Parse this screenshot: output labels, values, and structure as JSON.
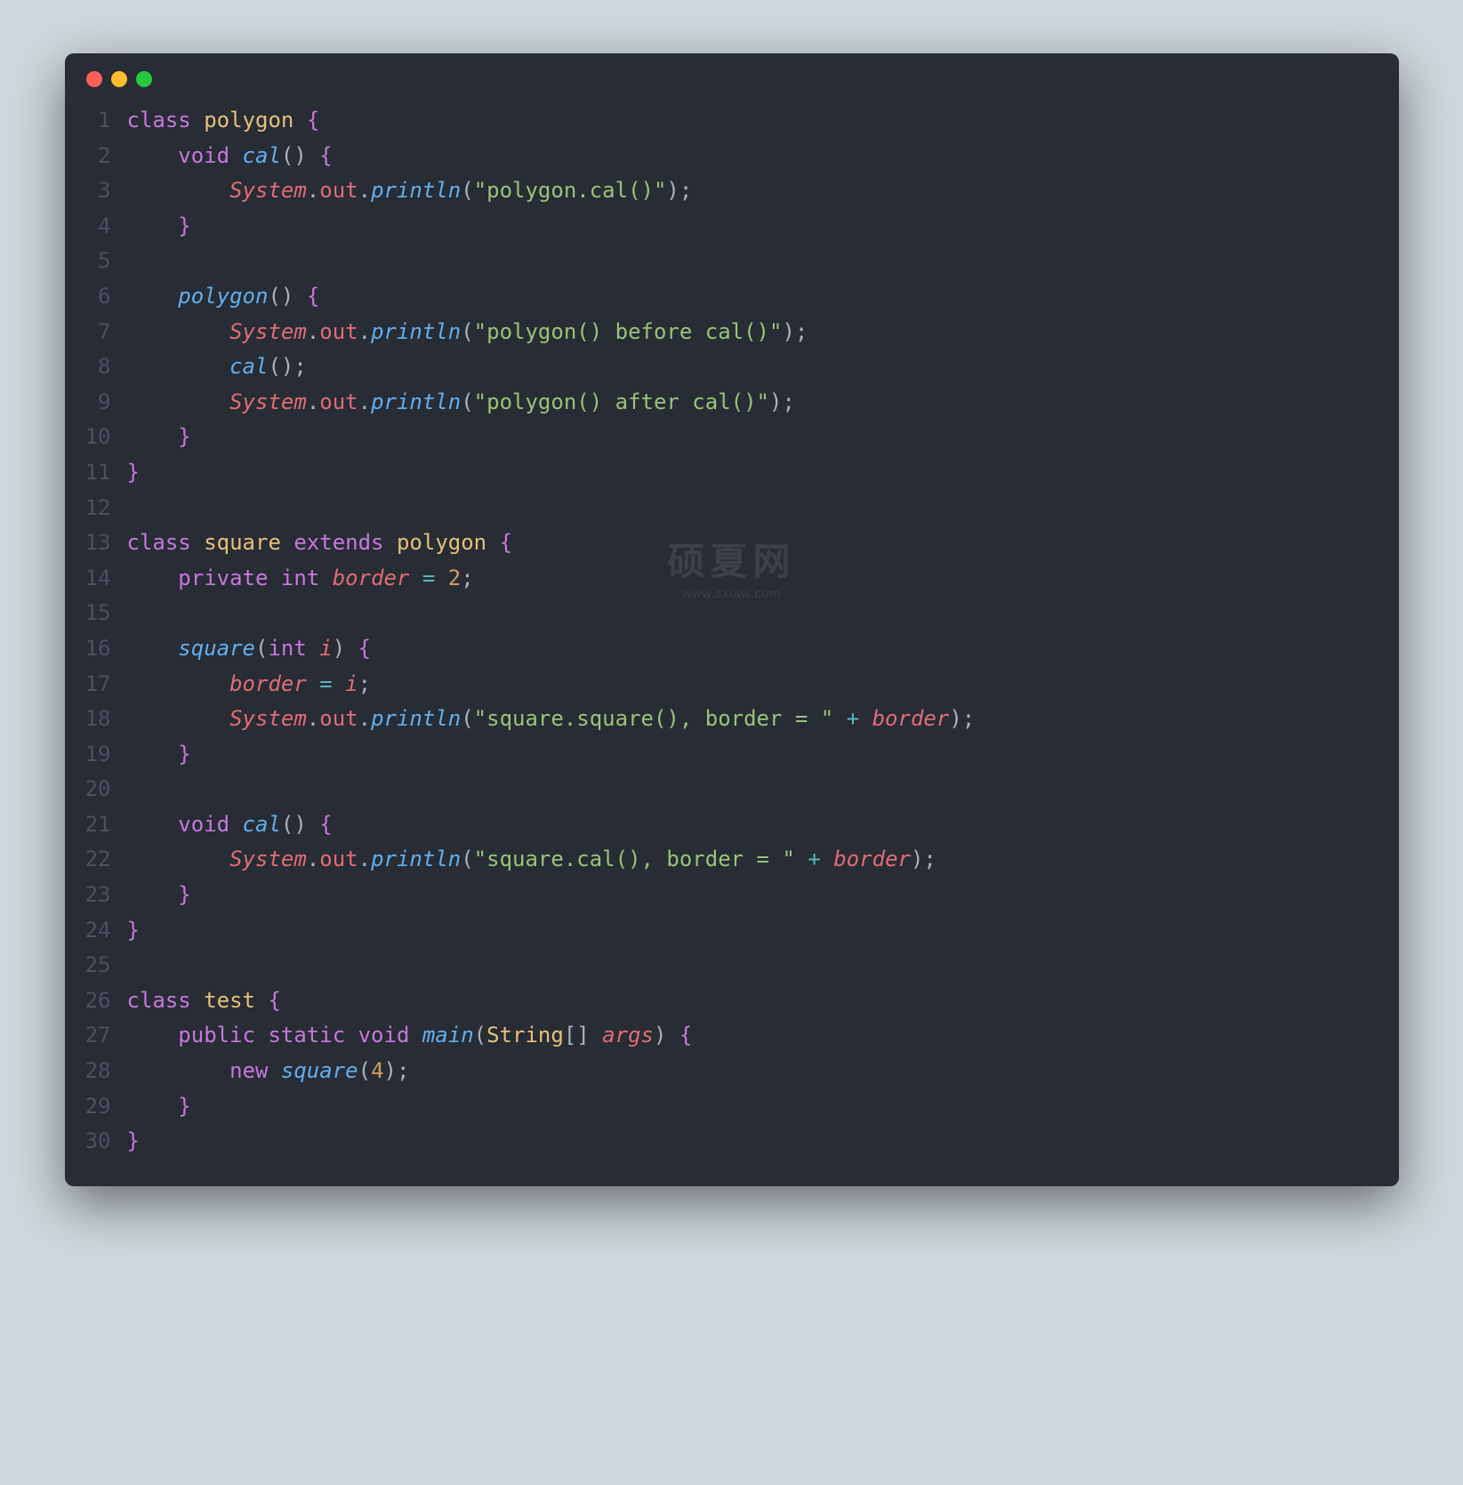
{
  "watermark": {
    "title": "硕夏网",
    "sub": "www.sxiaw.com"
  },
  "lines": [
    {
      "n": 1,
      "tokens": [
        [
          "kw",
          "class"
        ],
        [
          "pn",
          " "
        ],
        [
          "cls",
          "polygon"
        ],
        [
          "pn",
          " "
        ],
        [
          "pn-br",
          "{"
        ]
      ]
    },
    {
      "n": 2,
      "tokens": [
        [
          "pn",
          "    "
        ],
        [
          "kw",
          "void"
        ],
        [
          "pn",
          " "
        ],
        [
          "fn",
          "cal"
        ],
        [
          "pn",
          "() "
        ],
        [
          "pn-br",
          "{"
        ]
      ]
    },
    {
      "n": 3,
      "tokens": [
        [
          "pn",
          "        "
        ],
        [
          "id",
          "System"
        ],
        [
          "pn",
          "."
        ],
        [
          "field",
          "out"
        ],
        [
          "pn",
          "."
        ],
        [
          "fn",
          "println"
        ],
        [
          "pn",
          "("
        ],
        [
          "str",
          "\"polygon.cal()\""
        ],
        [
          "pn",
          ");"
        ]
      ]
    },
    {
      "n": 4,
      "tokens": [
        [
          "pn",
          "    "
        ],
        [
          "pn-br",
          "}"
        ]
      ]
    },
    {
      "n": 5,
      "tokens": []
    },
    {
      "n": 6,
      "tokens": [
        [
          "pn",
          "    "
        ],
        [
          "fn",
          "polygon"
        ],
        [
          "pn",
          "() "
        ],
        [
          "pn-br",
          "{"
        ]
      ]
    },
    {
      "n": 7,
      "tokens": [
        [
          "pn",
          "        "
        ],
        [
          "id",
          "System"
        ],
        [
          "pn",
          "."
        ],
        [
          "field",
          "out"
        ],
        [
          "pn",
          "."
        ],
        [
          "fn",
          "println"
        ],
        [
          "pn",
          "("
        ],
        [
          "str",
          "\"polygon() before cal()\""
        ],
        [
          "pn",
          ");"
        ]
      ]
    },
    {
      "n": 8,
      "tokens": [
        [
          "pn",
          "        "
        ],
        [
          "fn",
          "cal"
        ],
        [
          "pn",
          "();"
        ]
      ]
    },
    {
      "n": 9,
      "tokens": [
        [
          "pn",
          "        "
        ],
        [
          "id",
          "System"
        ],
        [
          "pn",
          "."
        ],
        [
          "field",
          "out"
        ],
        [
          "pn",
          "."
        ],
        [
          "fn",
          "println"
        ],
        [
          "pn",
          "("
        ],
        [
          "str",
          "\"polygon() after cal()\""
        ],
        [
          "pn",
          ");"
        ]
      ]
    },
    {
      "n": 10,
      "tokens": [
        [
          "pn",
          "    "
        ],
        [
          "pn-br",
          "}"
        ]
      ]
    },
    {
      "n": 11,
      "tokens": [
        [
          "pn-br",
          "}"
        ]
      ]
    },
    {
      "n": 12,
      "tokens": []
    },
    {
      "n": 13,
      "tokens": [
        [
          "kw",
          "class"
        ],
        [
          "pn",
          " "
        ],
        [
          "cls",
          "square"
        ],
        [
          "pn",
          " "
        ],
        [
          "kw",
          "extends"
        ],
        [
          "pn",
          " "
        ],
        [
          "cls",
          "polygon"
        ],
        [
          "pn",
          " "
        ],
        [
          "pn-br",
          "{"
        ]
      ]
    },
    {
      "n": 14,
      "tokens": [
        [
          "pn",
          "    "
        ],
        [
          "kw",
          "private"
        ],
        [
          "pn",
          " "
        ],
        [
          "kw",
          "int"
        ],
        [
          "pn",
          " "
        ],
        [
          "id",
          "border"
        ],
        [
          "pn",
          " "
        ],
        [
          "op",
          "="
        ],
        [
          "pn",
          " "
        ],
        [
          "num",
          "2"
        ],
        [
          "pn",
          ";"
        ]
      ]
    },
    {
      "n": 15,
      "tokens": []
    },
    {
      "n": 16,
      "tokens": [
        [
          "pn",
          "    "
        ],
        [
          "fn",
          "square"
        ],
        [
          "pn",
          "("
        ],
        [
          "kw",
          "int"
        ],
        [
          "pn",
          " "
        ],
        [
          "param",
          "i"
        ],
        [
          "pn",
          ") "
        ],
        [
          "pn-br",
          "{"
        ]
      ]
    },
    {
      "n": 17,
      "tokens": [
        [
          "pn",
          "        "
        ],
        [
          "id",
          "border"
        ],
        [
          "pn",
          " "
        ],
        [
          "op",
          "="
        ],
        [
          "pn",
          " "
        ],
        [
          "id",
          "i"
        ],
        [
          "pn",
          ";"
        ]
      ]
    },
    {
      "n": 18,
      "tokens": [
        [
          "pn",
          "        "
        ],
        [
          "id",
          "System"
        ],
        [
          "pn",
          "."
        ],
        [
          "field",
          "out"
        ],
        [
          "pn",
          "."
        ],
        [
          "fn",
          "println"
        ],
        [
          "pn",
          "("
        ],
        [
          "str",
          "\"square.square(), border = \""
        ],
        [
          "pn",
          " "
        ],
        [
          "op",
          "+"
        ],
        [
          "pn",
          " "
        ],
        [
          "id",
          "border"
        ],
        [
          "pn",
          ");"
        ]
      ]
    },
    {
      "n": 19,
      "tokens": [
        [
          "pn",
          "    "
        ],
        [
          "pn-br",
          "}"
        ]
      ]
    },
    {
      "n": 20,
      "tokens": []
    },
    {
      "n": 21,
      "tokens": [
        [
          "pn",
          "    "
        ],
        [
          "kw",
          "void"
        ],
        [
          "pn",
          " "
        ],
        [
          "fn",
          "cal"
        ],
        [
          "pn",
          "() "
        ],
        [
          "pn-br",
          "{"
        ]
      ]
    },
    {
      "n": 22,
      "tokens": [
        [
          "pn",
          "        "
        ],
        [
          "id",
          "System"
        ],
        [
          "pn",
          "."
        ],
        [
          "field",
          "out"
        ],
        [
          "pn",
          "."
        ],
        [
          "fn",
          "println"
        ],
        [
          "pn",
          "("
        ],
        [
          "str",
          "\"square.cal(), border = \""
        ],
        [
          "pn",
          " "
        ],
        [
          "op",
          "+"
        ],
        [
          "pn",
          " "
        ],
        [
          "id",
          "border"
        ],
        [
          "pn",
          ");"
        ]
      ]
    },
    {
      "n": 23,
      "tokens": [
        [
          "pn",
          "    "
        ],
        [
          "pn-br",
          "}"
        ]
      ]
    },
    {
      "n": 24,
      "tokens": [
        [
          "pn-br",
          "}"
        ]
      ]
    },
    {
      "n": 25,
      "tokens": []
    },
    {
      "n": 26,
      "tokens": [
        [
          "kw",
          "class"
        ],
        [
          "pn",
          " "
        ],
        [
          "cls",
          "test"
        ],
        [
          "pn",
          " "
        ],
        [
          "pn-br",
          "{"
        ]
      ]
    },
    {
      "n": 27,
      "tokens": [
        [
          "pn",
          "    "
        ],
        [
          "kw",
          "public"
        ],
        [
          "pn",
          " "
        ],
        [
          "kw",
          "static"
        ],
        [
          "pn",
          " "
        ],
        [
          "kw",
          "void"
        ],
        [
          "pn",
          " "
        ],
        [
          "fn",
          "main"
        ],
        [
          "pn",
          "("
        ],
        [
          "cls",
          "String"
        ],
        [
          "pn",
          "[] "
        ],
        [
          "param",
          "args"
        ],
        [
          "pn",
          ") "
        ],
        [
          "pn-br",
          "{"
        ]
      ]
    },
    {
      "n": 28,
      "tokens": [
        [
          "pn",
          "        "
        ],
        [
          "kw",
          "new"
        ],
        [
          "pn",
          " "
        ],
        [
          "fn",
          "square"
        ],
        [
          "pn",
          "("
        ],
        [
          "num",
          "4"
        ],
        [
          "pn",
          ");"
        ]
      ]
    },
    {
      "n": 29,
      "tokens": [
        [
          "pn",
          "    "
        ],
        [
          "pn-br",
          "}"
        ]
      ]
    },
    {
      "n": 30,
      "tokens": [
        [
          "pn-br",
          "}"
        ]
      ]
    }
  ]
}
